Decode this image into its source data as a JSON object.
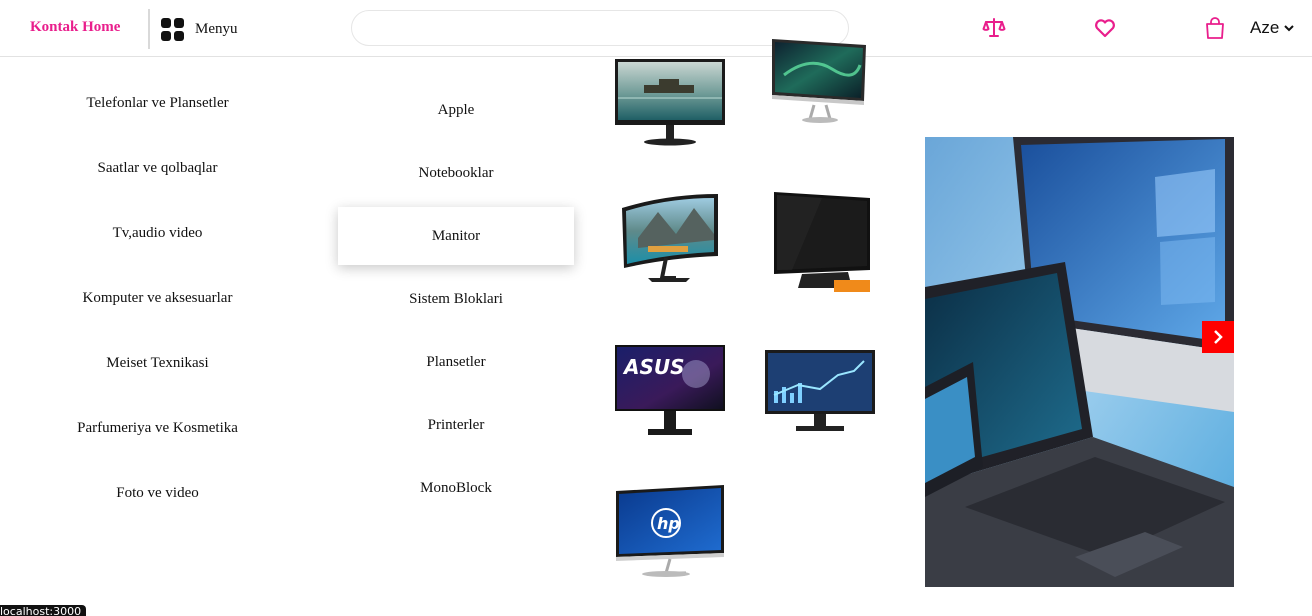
{
  "header": {
    "brand": "Kontak Home",
    "menu_label": "Menyu",
    "language": "Aze",
    "icons": [
      "compare-scale-icon",
      "heart-icon",
      "shopping-bag-icon"
    ],
    "accent_color": "#e91e8c"
  },
  "categories": [
    {
      "label": "Telefonlar ve Plansetler"
    },
    {
      "label": "Saatlar ve qolbaqlar"
    },
    {
      "label": "Tv,audio video"
    },
    {
      "label": "Komputer ve aksesuarlar"
    },
    {
      "label": "Meiset Texnikasi"
    },
    {
      "label": "Parfumeriya ve Kosmetika"
    },
    {
      "label": "Foto ve video"
    }
  ],
  "subcategories": {
    "active": "Manitor",
    "items": [
      {
        "label": "Apple"
      },
      {
        "label": "Notebooklar"
      },
      {
        "label": "Manitor"
      },
      {
        "label": "Sistem Bloklari"
      },
      {
        "label": "Plansetler"
      },
      {
        "label": "Printerler"
      },
      {
        "label": "MonoBlock"
      }
    ]
  },
  "products": [
    {
      "name": "monitor-lake-image",
      "brand_text": ""
    },
    {
      "name": "monitor-aurora-image",
      "brand_text": ""
    },
    {
      "name": "monitor-curved-mountains-image",
      "brand_text": ""
    },
    {
      "name": "monitor-black-screen-image",
      "brand_text": ""
    },
    {
      "name": "monitor-asus-gaming-image",
      "brand_text": "ASUS"
    },
    {
      "name": "monitor-chart-image",
      "brand_text": ""
    },
    {
      "name": "monitor-hp-image",
      "brand_text": "hp"
    }
  ],
  "banner": {
    "next_icon": "chevron-right-icon",
    "button_color": "#ff0000"
  },
  "status_bar": {
    "text": "localhost:3000"
  }
}
